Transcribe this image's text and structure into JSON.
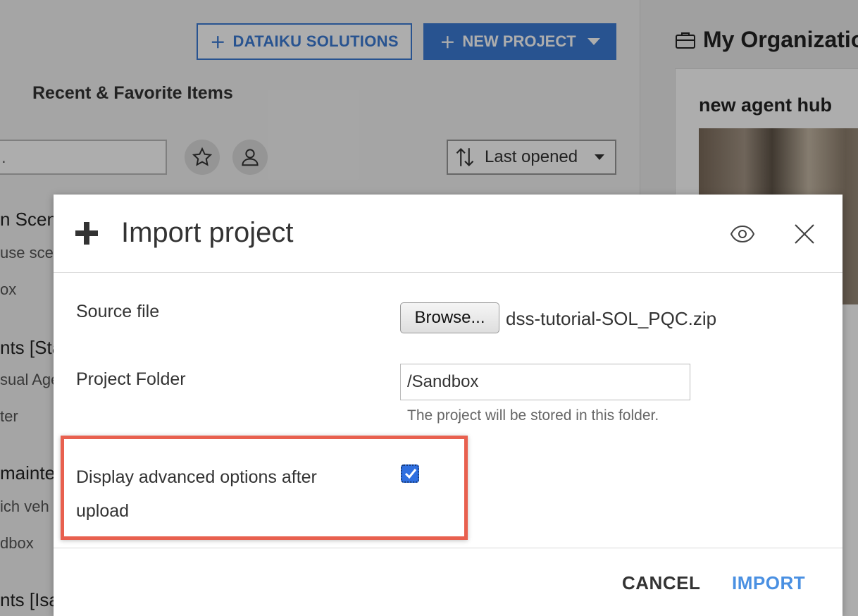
{
  "background": {
    "solutions_button": "DATAIKU SOLUTIONS",
    "new_project_button": "NEW PROJECT",
    "recent_title": "Recent & Favorite Items",
    "search_value": ".",
    "sort_label": "Last opened",
    "org_title": "My Organizatio",
    "org_card_title": "new agent hub",
    "list_fragments": [
      {
        "title": "n Scen",
        "sub": "use scer",
        "tag": "ox"
      },
      {
        "title": "nts [Sta",
        "sub": "sual Age",
        "tag": "ter"
      },
      {
        "title": "mainte",
        "sub": "ich veh",
        "tag": "dbox"
      },
      {
        "title": "nts [Isa",
        "sub": "",
        "tag": ""
      }
    ]
  },
  "modal": {
    "title": "Import project",
    "source_file_label": "Source file",
    "browse_label": "Browse...",
    "file_name": "dss-tutorial-SOL_PQC.zip",
    "folder_label": "Project Folder",
    "folder_value": "/Sandbox",
    "folder_help": "The project will be stored in this folder.",
    "advanced_label": "Display advanced options after upload",
    "advanced_checked": true,
    "cancel_label": "CANCEL",
    "import_label": "IMPORT"
  },
  "colors": {
    "accent": "#3b7bd4",
    "import_link": "#4a90e2",
    "highlight": "#e8604f"
  }
}
